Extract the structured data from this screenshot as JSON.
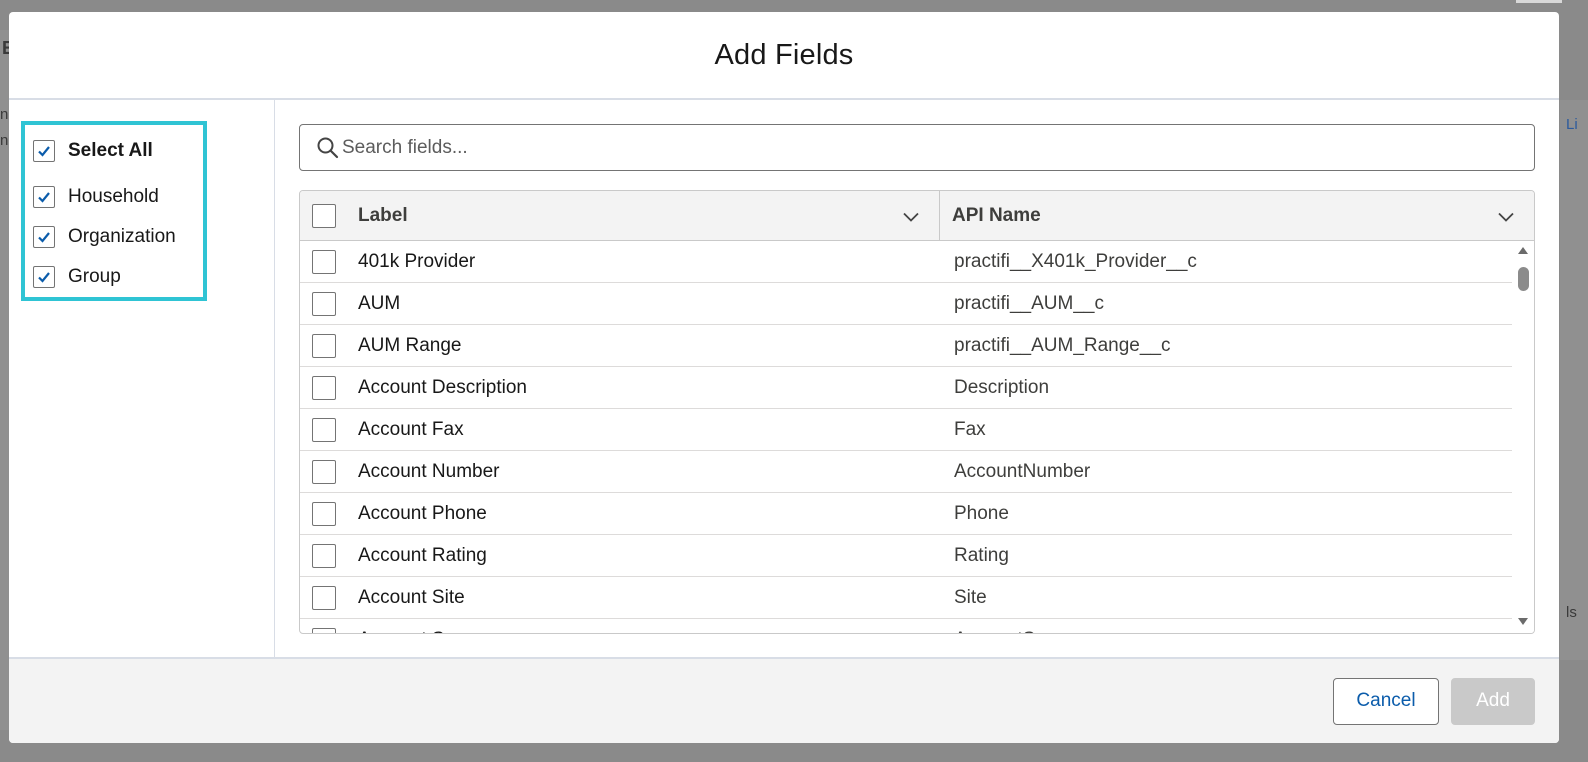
{
  "background": {
    "fragments": [
      "E",
      "nc",
      "nc",
      "Li",
      "ls"
    ]
  },
  "modal": {
    "title": "Add Fields"
  },
  "type_filter": {
    "select_all_label": "Select All",
    "items": [
      {
        "label": "Household",
        "checked": true
      },
      {
        "label": "Organization",
        "checked": true
      },
      {
        "label": "Group",
        "checked": true
      }
    ]
  },
  "search": {
    "placeholder": "Search fields...",
    "value": ""
  },
  "table": {
    "columns": [
      "Label",
      "API Name"
    ],
    "rows": [
      {
        "label": "401k Provider",
        "api": "practifi__X401k_Provider__c"
      },
      {
        "label": "AUM",
        "api": "practifi__AUM__c"
      },
      {
        "label": "AUM Range",
        "api": "practifi__AUM_Range__c"
      },
      {
        "label": "Account Description",
        "api": "Description"
      },
      {
        "label": "Account Fax",
        "api": "Fax"
      },
      {
        "label": "Account Number",
        "api": "AccountNumber"
      },
      {
        "label": "Account Phone",
        "api": "Phone"
      },
      {
        "label": "Account Rating",
        "api": "Rating"
      },
      {
        "label": "Account Site",
        "api": "Site"
      },
      {
        "label": "Account Source",
        "api": "AccountSource"
      }
    ]
  },
  "footer": {
    "cancel_label": "Cancel",
    "add_label": "Add"
  },
  "colors": {
    "highlight_border": "#2fc4d4",
    "brand_blue": "#0b5cab",
    "disabled_button": "#c9c9c9"
  }
}
